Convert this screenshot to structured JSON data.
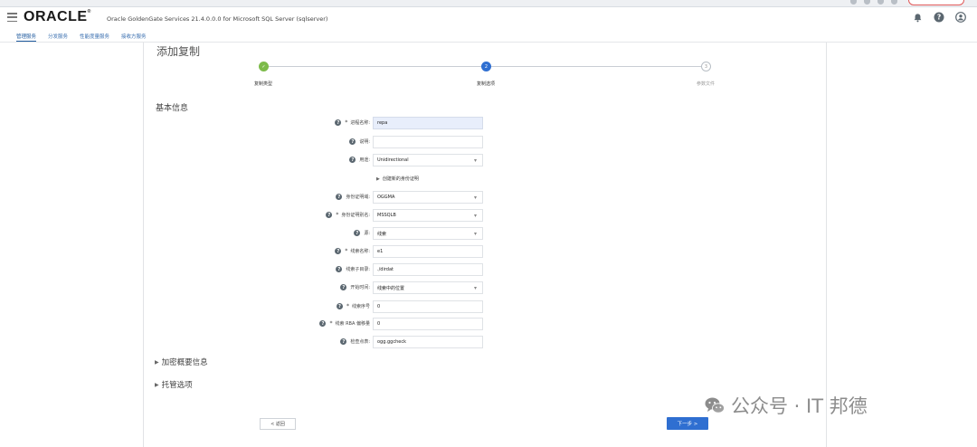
{
  "header": {
    "logo": "ORACLE",
    "app_title": "Oracle GoldenGate Services 21.4.0.0.0 for Microsoft SQL Server (sqlserver)"
  },
  "nav": {
    "tabs": [
      "管理服务",
      "分发服务",
      "性能度量服务",
      "接收方服务"
    ]
  },
  "page": {
    "title": "添加复制"
  },
  "stepper": {
    "steps": [
      {
        "label": "复制类型",
        "state": "done",
        "marker": "✓"
      },
      {
        "label": "复制选项",
        "state": "active",
        "marker": "2"
      },
      {
        "label": "参数文件",
        "state": "todo",
        "marker": "3"
      }
    ]
  },
  "form": {
    "section_title": "基本信息",
    "fields": {
      "process_name": {
        "label": "进程名称:",
        "required": "*",
        "value": "repa"
      },
      "description": {
        "label": "说明:",
        "value": ""
      },
      "intent": {
        "label": "用途:",
        "value": "Unidirectional"
      },
      "create_credential_link": "创建新的身份证明",
      "credential_domain": {
        "label": "身份证明域:",
        "value": "OGGMA"
      },
      "credential_alias": {
        "label": "身份证明别名:",
        "required": "*",
        "value": "MSSQLB"
      },
      "source": {
        "label": "源:",
        "value": "线索"
      },
      "trail_name": {
        "label": "线索名称:",
        "required": "*",
        "value": "e1"
      },
      "trail_subdir": {
        "label": "线索子目录:",
        "value": "./dirdat"
      },
      "begin": {
        "label": "开始时间:",
        "value": "线索中的位置"
      },
      "trail_seq": {
        "label": "线索序号",
        "required": "*",
        "value": "0"
      },
      "trail_rba": {
        "label": "线索 RBA 偏移量",
        "required": "*",
        "value": "0"
      },
      "checkpoint_table": {
        "label": "检查点表:",
        "value": "ogg.ggcheck"
      }
    },
    "encryption_profile": "加密概要信息",
    "managed_options": "托管选项"
  },
  "buttons": {
    "back": "< 返回",
    "next": "下一步 >"
  },
  "watermark": {
    "text": "公众号 · IT 邦德"
  },
  "icons": {
    "bell": "bell-icon",
    "help": "help-icon",
    "user": "user-icon"
  }
}
